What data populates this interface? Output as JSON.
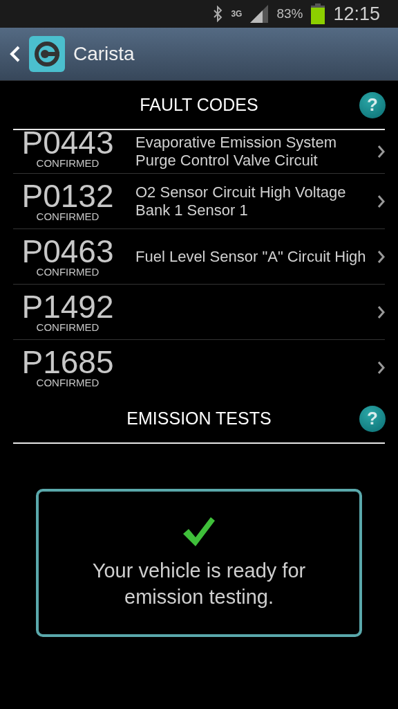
{
  "status_bar": {
    "network": "3G",
    "battery": "83%",
    "time": "12:15"
  },
  "action_bar": {
    "title": "Carista"
  },
  "fault_codes": {
    "title": "FAULT CODES",
    "help": "?",
    "rows": [
      {
        "code": "P0443",
        "status": "CONFIRMED",
        "description": "Evaporative Emission System Purge Control Valve Circuit"
      },
      {
        "code": "P0132",
        "status": "CONFIRMED",
        "description": "O2 Sensor Circuit High Voltage Bank 1 Sensor 1"
      },
      {
        "code": "P0463",
        "status": "CONFIRMED",
        "description": "Fuel Level Sensor \"A\" Circuit High"
      },
      {
        "code": "P1492",
        "status": "CONFIRMED"
      },
      {
        "code": "P1685",
        "status": "CONFIRMED"
      }
    ]
  },
  "emission_tests": {
    "title": "EMISSION TESTS",
    "help": "?",
    "message": "Your vehicle is ready for emission testing."
  }
}
